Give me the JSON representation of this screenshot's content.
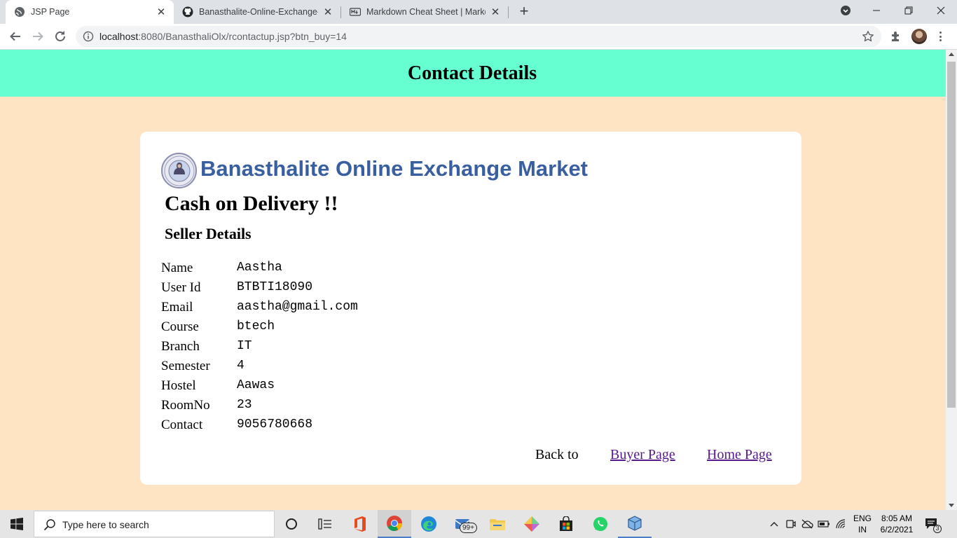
{
  "browser": {
    "tabs": [
      {
        "title": "JSP Page",
        "icon": "globe-icon",
        "active": true
      },
      {
        "title": "Banasthalite-Online-Exchange-M",
        "icon": "github-icon",
        "active": false
      },
      {
        "title": "Markdown Cheat Sheet | Markdo",
        "icon": "markdown-icon",
        "active": false
      }
    ],
    "url_host": "localhost",
    "url_path": ":8080/BanasthaliOlx/rcontactup.jsp?btn_buy=14"
  },
  "page": {
    "header_title": "Contact Details",
    "brand": "Banasthalite Online Exchange Market",
    "heading": "Cash on Delivery !!",
    "subheading": "Seller Details",
    "details": [
      {
        "label": "Name",
        "value": "Aastha"
      },
      {
        "label": "User Id",
        "value": "BTBTI18090"
      },
      {
        "label": "Email",
        "value": "aastha@gmail.com"
      },
      {
        "label": "Course",
        "value": "btech"
      },
      {
        "label": "Branch",
        "value": "IT"
      },
      {
        "label": "Semester",
        "value": "4"
      },
      {
        "label": "Hostel",
        "value": "Aawas"
      },
      {
        "label": "RoomNo",
        "value": "23"
      },
      {
        "label": "Contact",
        "value": "9056780668"
      }
    ],
    "back_to": "Back to",
    "buyer_link": "Buyer Page",
    "home_link": "Home Page",
    "colors": {
      "header_bg": "#66ffd2",
      "page_bg": "#ffe4c4",
      "brand": "#3a5fa0",
      "link": "#551a8b"
    }
  },
  "taskbar": {
    "search_placeholder": "Type here to search",
    "mail_badge": "99+",
    "lang_line1": "ENG",
    "lang_line2": "IN",
    "time": "8:05 AM",
    "date": "6/2/2021",
    "notification_count": "3"
  }
}
